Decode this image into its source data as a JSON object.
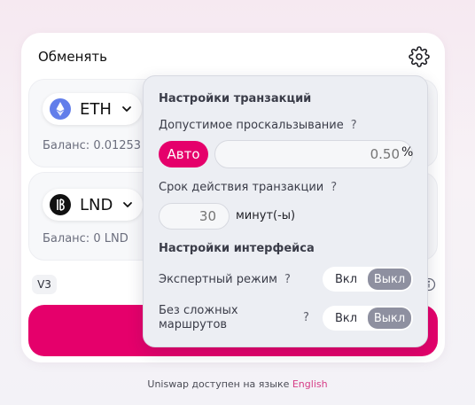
{
  "swap": {
    "title": "Обменять",
    "settings_icon": "gear-icon",
    "input_token": {
      "symbol": "ETH",
      "balance_label": "Баланс: 0.01253"
    },
    "output_token": {
      "symbol": "LND",
      "balance_label": "Баланс: 0 LND"
    },
    "version_badge": "V3"
  },
  "settings": {
    "transaction_heading": "Настройки транзакций",
    "slippage_label": "Допустимое проскальзывание",
    "slippage_auto_label": "Авто",
    "slippage_placeholder": "0.50",
    "slippage_unit": "%",
    "deadline_label": "Срок действия транзакции",
    "deadline_placeholder": "30",
    "deadline_unit": "минут(-ы)",
    "interface_heading": "Настройки интерфейса",
    "help_mark": "?",
    "expert_mode": {
      "label": "Экспертный режим",
      "on_label": "Вкл",
      "off_label": "Выкл",
      "selected": "off"
    },
    "multihop": {
      "label_line1": "Без сложных",
      "label_line2": "маршрутов",
      "on_label": "Вкл",
      "off_label": "Выкл",
      "selected": "off"
    }
  },
  "footer": {
    "text": "Uniswap доступен на языке",
    "language_link": "English"
  },
  "colors": {
    "accent": "#e5006b",
    "eth_blue": "#627eea",
    "toggle_active": "#8e90a0"
  }
}
